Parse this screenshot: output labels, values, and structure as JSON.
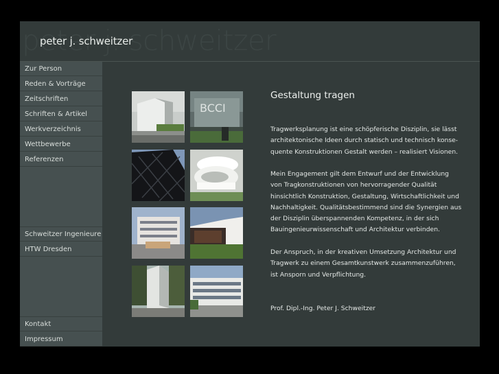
{
  "header": {
    "watermark": "peter j. schweitzer",
    "title": "peter j. schweitzer"
  },
  "nav": {
    "main": [
      "Zur Person",
      "Reden & Vorträge",
      "Zeitschriften",
      "Schriften & Artikel",
      "Werkverzeichnis",
      "Wettbewerbe",
      "Referenzen"
    ],
    "secondary": [
      "Schweitzer Ingenieure",
      "HTW Dresden"
    ],
    "footer": [
      "Kontakt",
      "Impressum"
    ]
  },
  "content": {
    "title": "Gestaltung tragen",
    "para1_lines": [
      "Tragwerksplanung ist eine schöpferische Disziplin, sie lässt",
      "architektonische Ideen durch statisch und technisch konse-",
      "quente Konstruktionen Gestalt werden – realisiert Visionen."
    ],
    "para2_lines": [
      "Mein Engagement gilt dem Entwurf und der Entwicklung",
      "von Tragkonstruktionen von hervorragender Qualität",
      "hinsichtlich Konstruktion, Gestaltung, Wirtschaftlichkeit und",
      "Nachhaltigkeit. Qualitätsbestimmend sind die Synergien aus",
      "der Disziplin überspannenden Kompetenz, in der sich",
      "Bauingenieurwissenschaft und Architektur verbinden."
    ],
    "para3_lines": [
      "Der Anspruch, in der kreativen Umsetzung Architektur und",
      "Tragwerk zu einem Gesamtkunstwerk zusammenzuführen,",
      "ist Ansporn und Verpflichtung."
    ],
    "signature": "Prof. Dipl.-Ing. Peter J. Schweitzer"
  },
  "gallery": {
    "sign_text": "BCCI"
  }
}
